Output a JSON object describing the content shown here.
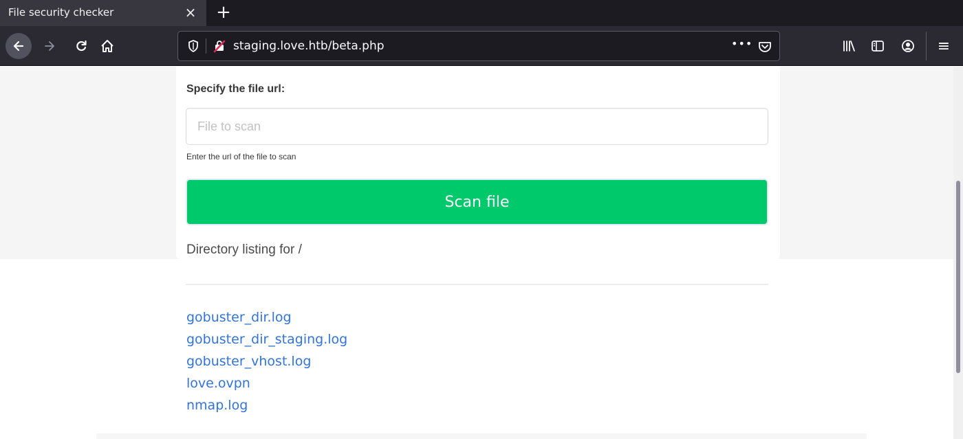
{
  "browser": {
    "tab_title": "File security checker",
    "tab_close": "×",
    "new_tab": "+",
    "url": "staging.love.htb/beta.php",
    "url_more": "•••",
    "menu": "≡"
  },
  "form": {
    "label": "Specify the file url:",
    "input_value": "",
    "input_placeholder": "File to scan",
    "help": "Enter the url of the file to scan",
    "scan_button": "Scan file",
    "scan_button_color": "#00c96b"
  },
  "directory": {
    "title": "Directory listing for /",
    "files": [
      "gobuster_dir.log",
      "gobuster_dir_staging.log",
      "gobuster_vhost.log",
      "love.ovpn",
      "nmap.log"
    ],
    "link_color": "#3273dc"
  },
  "icons": [
    "back-icon",
    "forward-icon",
    "reload-icon",
    "home-icon",
    "shield-icon",
    "insecure-lock-icon",
    "pocket-icon",
    "library-icon",
    "sidebar-icon",
    "account-icon",
    "menu-icon"
  ]
}
